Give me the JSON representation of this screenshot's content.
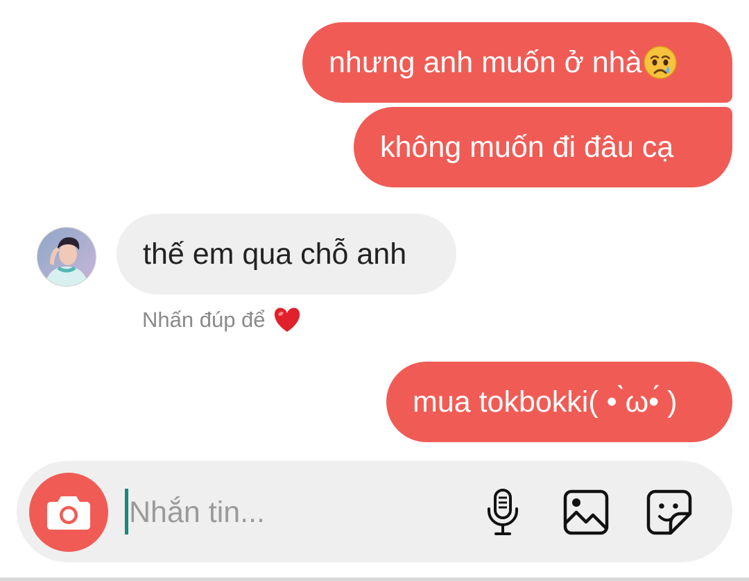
{
  "messages": [
    {
      "direction": "sent",
      "text": "nhưng anh muốn ở nhà",
      "emoji": "crying-face"
    },
    {
      "direction": "sent",
      "text": "không muốn đi đâu cạ"
    },
    {
      "direction": "received",
      "text": "thế em qua chỗ anh",
      "avatar": "user-avatar"
    },
    {
      "direction": "sent",
      "text": "mua tokbokki( • ̀ω•́ )"
    }
  ],
  "hint": {
    "text": "Nhấn đúp để",
    "icon": "heart-icon"
  },
  "composer": {
    "placeholder": "Nhắn tin...",
    "value": "",
    "icons": [
      "camera-icon",
      "microphone-icon",
      "image-icon",
      "sticker-icon"
    ]
  },
  "colors": {
    "sent_bubble": "#f05c55",
    "received_bubble": "#efefef",
    "composer_bg": "#efefef",
    "caret": "#178a7a",
    "heart": "#e0202a"
  }
}
